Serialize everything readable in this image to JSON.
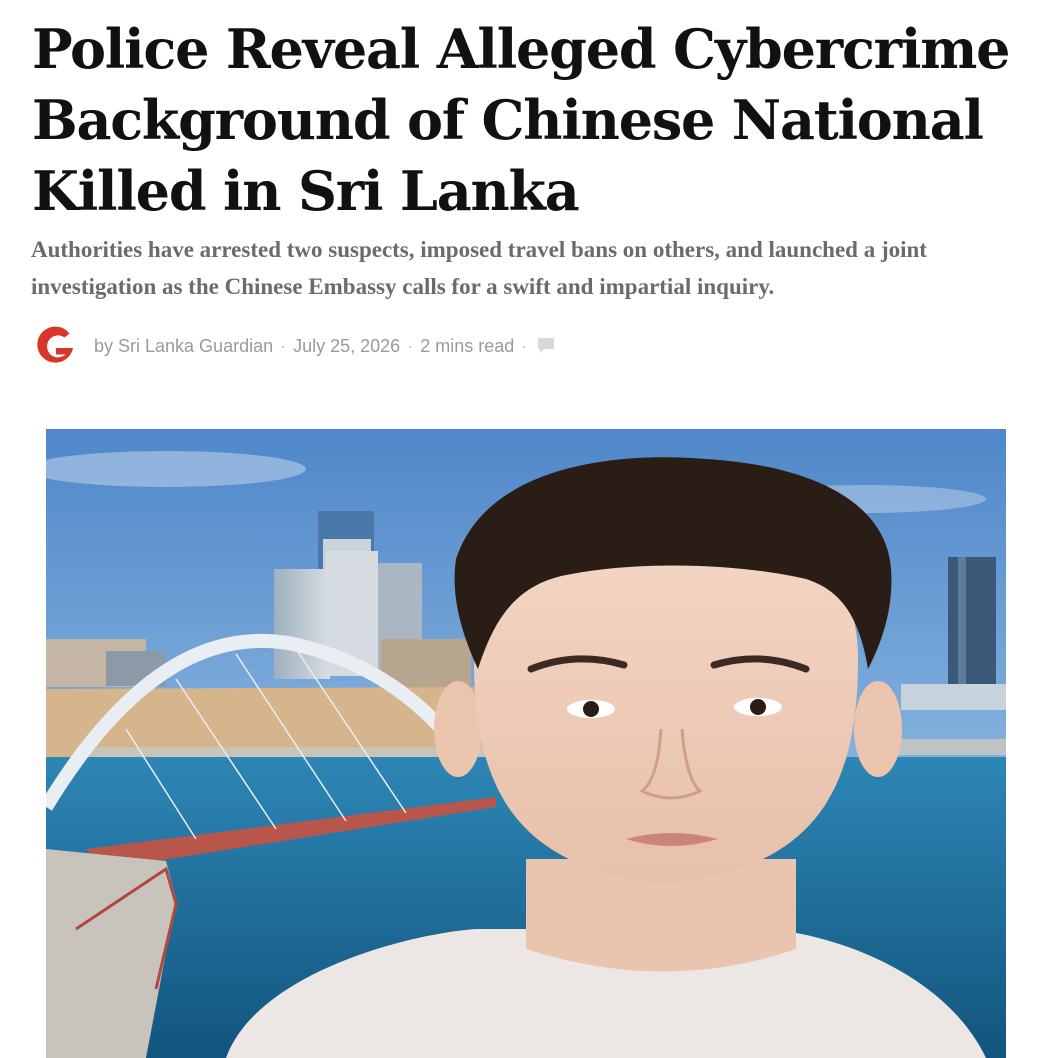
{
  "article": {
    "headline": "Police Reveal Alleged Cybercrime Background of Chinese National Killed in Sri Lanka",
    "subheadline": "Authorities have arrested two suspects, imposed travel bans on others, and launched a joint investigation as the Chinese Embassy calls for a swift and impartial inquiry.",
    "byline": {
      "author": "by Sri Lanka Guardian",
      "date": "July 25, 2026",
      "read_time": "2 mins read",
      "separator": "·"
    },
    "publisher_logo_icon": "g-logo-icon",
    "comment_icon": "speech-bubble-icon",
    "hero_image": {
      "subject": "portrait-photo",
      "background": "city-skyline-harbor-arch-bridge"
    }
  },
  "colors": {
    "headline": "#111111",
    "subheadline": "#6b6b6b",
    "byline": "#9a9a9a",
    "logo_red": "#d9362b",
    "sky": "#5f93cf",
    "sea": "#1f6f9c"
  }
}
